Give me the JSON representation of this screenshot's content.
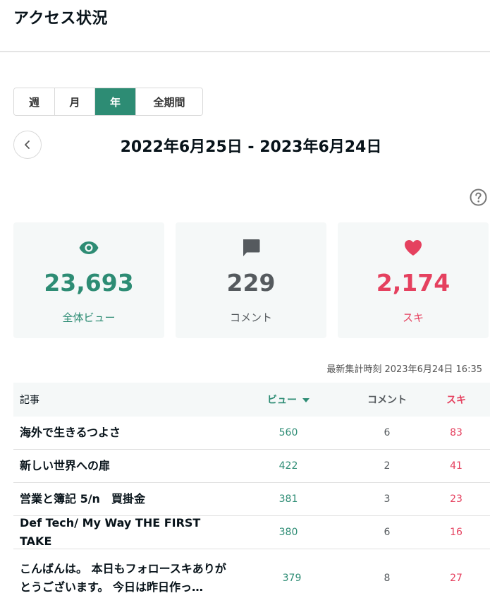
{
  "page": {
    "title": "アクセス状況"
  },
  "period_tabs": [
    {
      "label": "週",
      "active": false
    },
    {
      "label": "月",
      "active": false
    },
    {
      "label": "年",
      "active": true
    },
    {
      "label": "全期間",
      "active": false
    }
  ],
  "date_range": "2022年6月25日 - 2023年6月24日",
  "stats": {
    "views": {
      "value": "23,693",
      "label": "全体ビュー",
      "icon": "eye-icon"
    },
    "comments": {
      "value": "229",
      "label": "コメント",
      "icon": "comment-icon"
    },
    "likes": {
      "value": "2,174",
      "label": "スキ",
      "icon": "heart-icon"
    }
  },
  "updated_at": "最新集計時刻 2023年6月24日 16:35",
  "table": {
    "headers": {
      "article": "記事",
      "views": "ビュー",
      "comments": "コメント",
      "likes": "スキ"
    },
    "rows": [
      {
        "title": "海外で生きるつよさ",
        "views": "560",
        "comments": "6",
        "likes": "83"
      },
      {
        "title": "新しい世界への扉",
        "views": "422",
        "comments": "2",
        "likes": "41"
      },
      {
        "title": "営業と簿記 5/n　買掛金",
        "views": "381",
        "comments": "3",
        "likes": "23"
      },
      {
        "title": "Def Tech/ My Way THE FIRST TAKE",
        "views": "380",
        "comments": "6",
        "likes": "16"
      },
      {
        "title": "こんばんは。 本日もフォロースキありがとうございます。 今日は昨日作っ…",
        "views": "379",
        "comments": "8",
        "likes": "27"
      }
    ]
  },
  "colors": {
    "accent": "#2d8c74",
    "like": "#e5415f",
    "muted": "#555a5e",
    "card_bg": "#f5f8f8"
  }
}
